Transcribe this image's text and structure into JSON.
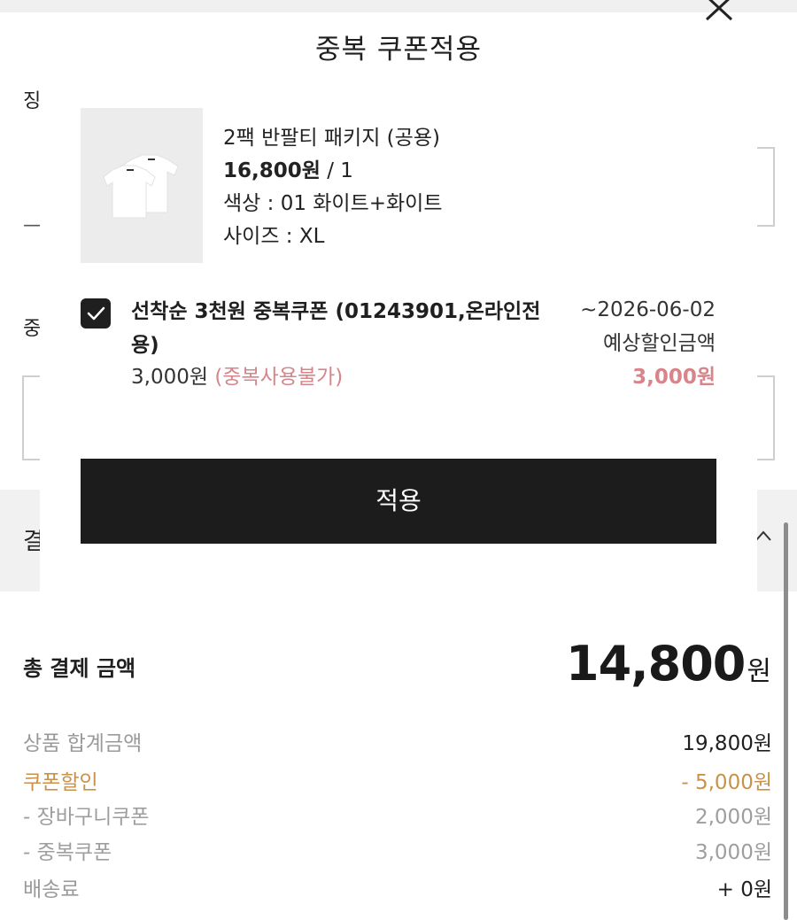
{
  "modal": {
    "title": "중복 쿠폰적용",
    "close_icon": "close-icon"
  },
  "product": {
    "name": "2팩 반팔티 패키지 (공용)",
    "price": "16,800원",
    "qty": " / 1",
    "color": "색상 : 01 화이트+화이트",
    "size": "사이즈 : XL"
  },
  "coupon": {
    "checked": true,
    "name": "선착순 3천원 중복쿠폰 (01243901,온라인전용)",
    "amount": "3,000원",
    "note": "(중복사용불가)",
    "expiry": "~2026-06-02",
    "est_label": "예상할인금액",
    "est_amount": "3,000원"
  },
  "apply_button": "적용",
  "background": {
    "label_top": "징",
    "label_mid": "중",
    "label_dash": "—",
    "label_band": "결"
  },
  "summary": {
    "total_label": "총 결제 금액",
    "total_amount": "14,800",
    "total_unit": "원",
    "rows": [
      {
        "label": "상품 합계금액",
        "value": "19,800원"
      },
      {
        "label": "쿠폰할인",
        "value": "- 5,000원"
      },
      {
        "label": "- 장바구니쿠폰",
        "value": "2,000원"
      },
      {
        "label": "- 중복쿠폰",
        "value": "3,000원"
      },
      {
        "label": "배송료",
        "value": "+ 0원"
      }
    ]
  },
  "colors": {
    "accent_gold": "#c8924a",
    "accent_pink": "#d7848a",
    "button_dark": "#1c1c1c"
  }
}
